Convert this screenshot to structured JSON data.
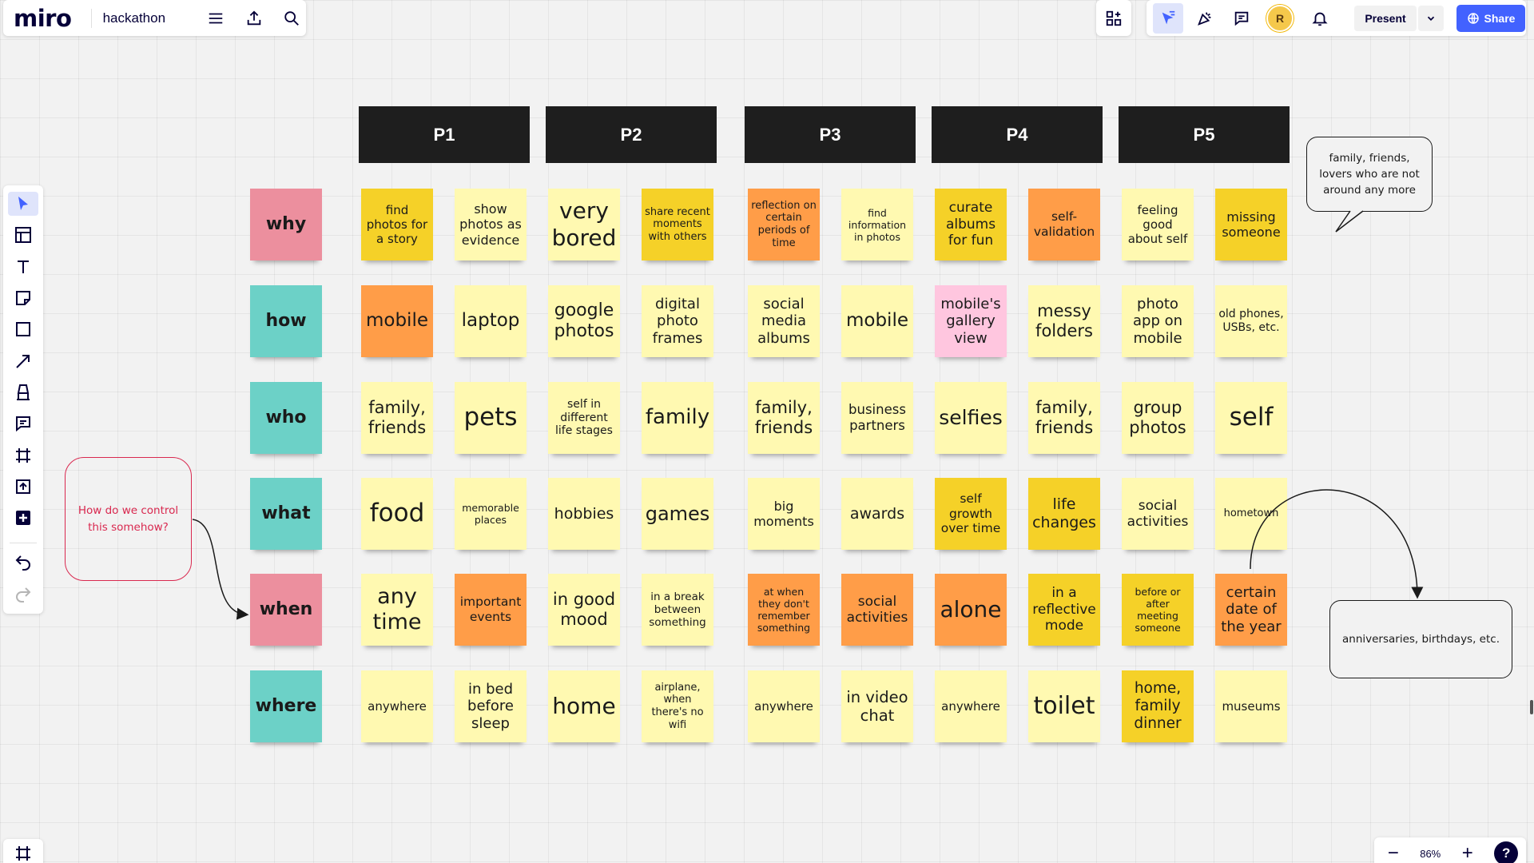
{
  "app": {
    "logo": "miro",
    "board_title": "hackathon",
    "present_label": "Present",
    "share_label": "Share",
    "avatar_initial": "R",
    "zoom_level": "86%",
    "zoom_out": "−",
    "zoom_in": "+",
    "help": "?"
  },
  "colors": {
    "yellow_light": "#fff9b1",
    "yellow": "#f5d128",
    "orange": "#ff9d48",
    "pink_light": "#ffc6df",
    "pink": "#ec8f9e",
    "teal": "#6cd1c7",
    "header_bg": "#1e1e1e",
    "accent": "#4262ff",
    "comment_red": "#d9284f"
  },
  "toolbar_icons": [
    "select-icon",
    "templates-icon",
    "text-icon",
    "sticky-note-icon",
    "shape-icon",
    "pen-icon",
    "marker-icon",
    "comment-icon",
    "frame-icon",
    "upload-icon",
    "more-apps-icon",
    "undo-icon",
    "redo-icon"
  ],
  "headers": [
    "P1",
    "P2",
    "P3",
    "P4",
    "P5"
  ],
  "rows": [
    {
      "label": "why",
      "color": "r",
      "cells": [
        {
          "text": "find photos for a story",
          "c": "Y",
          "fs": 15
        },
        {
          "text": "show photos as evidence",
          "c": "y",
          "fs": 16
        },
        {
          "text": "very bored",
          "c": "y",
          "fs": 28
        },
        {
          "text": "share recent moments with others",
          "c": "Y",
          "fs": 13
        },
        {
          "text": "reflection on certain periods of time",
          "c": "o",
          "fs": 13
        },
        {
          "text": "find information in photos",
          "c": "y",
          "fs": 12.5
        },
        {
          "text": "curate albums for fun",
          "c": "Y",
          "fs": 17
        },
        {
          "text": "self-validation",
          "c": "o",
          "fs": 15.5
        },
        {
          "text": "feeling good about self",
          "c": "y",
          "fs": 15
        },
        {
          "text": "missing someone",
          "c": "Y",
          "fs": 16
        }
      ]
    },
    {
      "label": "how",
      "color": "t",
      "cells": [
        {
          "text": "mobile",
          "c": "o",
          "fs": 23
        },
        {
          "text": "laptop",
          "c": "y",
          "fs": 23
        },
        {
          "text": "google photos",
          "c": "y",
          "fs": 22
        },
        {
          "text": "digital photo frames",
          "c": "y",
          "fs": 18
        },
        {
          "text": "social media albums",
          "c": "y",
          "fs": 18
        },
        {
          "text": "mobile",
          "c": "y",
          "fs": 23
        },
        {
          "text": "mobile's gallery view",
          "c": "p",
          "fs": 18
        },
        {
          "text": "messy folders",
          "c": "y",
          "fs": 21
        },
        {
          "text": "photo app on mobile",
          "c": "y",
          "fs": 18
        },
        {
          "text": "old phones, USBs, etc.",
          "c": "y",
          "fs": 14
        }
      ]
    },
    {
      "label": "who",
      "color": "t",
      "cells": [
        {
          "text": "family, friends",
          "c": "y",
          "fs": 21
        },
        {
          "text": "pets",
          "c": "y",
          "fs": 31
        },
        {
          "text": "self in different life stages",
          "c": "y",
          "fs": 14
        },
        {
          "text": "family",
          "c": "y",
          "fs": 26
        },
        {
          "text": "family, friends",
          "c": "y",
          "fs": 21
        },
        {
          "text": "business partners",
          "c": "y",
          "fs": 16.5
        },
        {
          "text": "selfies",
          "c": "y",
          "fs": 25
        },
        {
          "text": "family, friends",
          "c": "y",
          "fs": 21
        },
        {
          "text": "group photos",
          "c": "y",
          "fs": 21
        },
        {
          "text": "self",
          "c": "y",
          "fs": 31
        }
      ]
    },
    {
      "label": "what",
      "color": "t",
      "cells": [
        {
          "text": "food",
          "c": "y",
          "fs": 31
        },
        {
          "text": "memorable places",
          "c": "y",
          "fs": 12.5
        },
        {
          "text": "hobbies",
          "c": "y",
          "fs": 19
        },
        {
          "text": "games",
          "c": "y",
          "fs": 24
        },
        {
          "text": "big moments",
          "c": "y",
          "fs": 16
        },
        {
          "text": "awards",
          "c": "y",
          "fs": 19
        },
        {
          "text": "self growth over time",
          "c": "Y",
          "fs": 15.5
        },
        {
          "text": "life changes",
          "c": "Y",
          "fs": 19
        },
        {
          "text": "social activities",
          "c": "y",
          "fs": 17
        },
        {
          "text": "hometown",
          "c": "y",
          "fs": 13
        }
      ]
    },
    {
      "label": "when",
      "color": "r",
      "cells": [
        {
          "text": "any time",
          "c": "y",
          "fs": 27
        },
        {
          "text": "important events",
          "c": "o",
          "fs": 15.5
        },
        {
          "text": "in good mood",
          "c": "y",
          "fs": 21
        },
        {
          "text": "in a break between something",
          "c": "y",
          "fs": 13.5
        },
        {
          "text": "at when they don't remember something",
          "c": "o",
          "fs": 12.5
        },
        {
          "text": "social activities",
          "c": "o",
          "fs": 17
        },
        {
          "text": "alone",
          "c": "o",
          "fs": 28
        },
        {
          "text": "in a reflective mode",
          "c": "Y",
          "fs": 17
        },
        {
          "text": "before or after meeting someone",
          "c": "Y",
          "fs": 12.5
        },
        {
          "text": "certain date of the year",
          "c": "o",
          "fs": 18
        }
      ]
    },
    {
      "label": "where",
      "color": "t",
      "cells": [
        {
          "text": "anywhere",
          "c": "y",
          "fs": 15
        },
        {
          "text": "in bed before sleep",
          "c": "y",
          "fs": 18
        },
        {
          "text": "home",
          "c": "y",
          "fs": 28
        },
        {
          "text": "airplane, when there's no wifi",
          "c": "y",
          "fs": 13
        },
        {
          "text": "anywhere",
          "c": "y",
          "fs": 15
        },
        {
          "text": "in video chat",
          "c": "y",
          "fs": 19.5
        },
        {
          "text": "anywhere",
          "c": "y",
          "fs": 15
        },
        {
          "text": "toilet",
          "c": "y",
          "fs": 30
        },
        {
          "text": "home, family dinner",
          "c": "Y",
          "fs": 18.5
        },
        {
          "text": "museums",
          "c": "y",
          "fs": 15
        }
      ]
    }
  ],
  "bubbles": {
    "control": "How do we control this somehow?",
    "family": "family, friends, lovers who are not around any more",
    "anniversaries": "anniversaries, birthdays, etc."
  }
}
